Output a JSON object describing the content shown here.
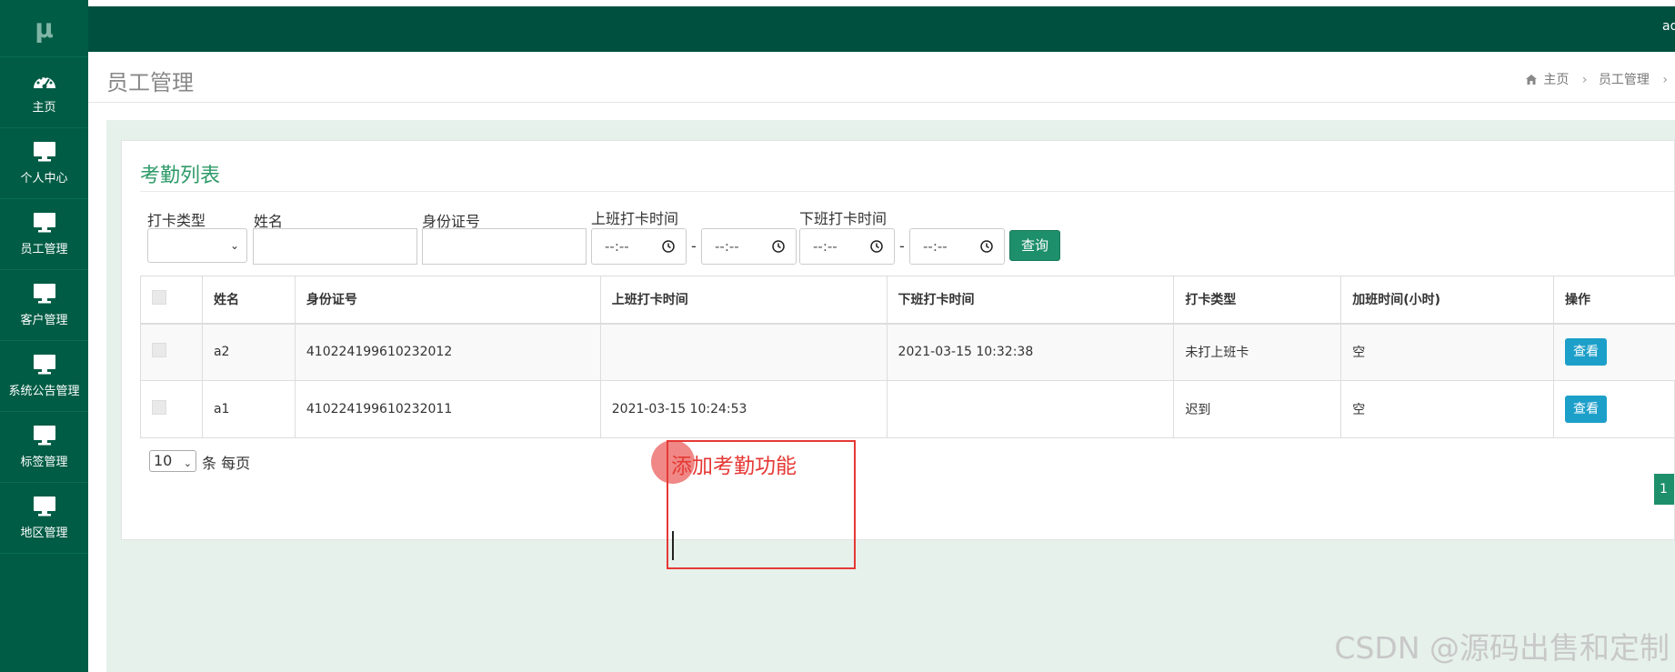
{
  "sidebar": {
    "logo": "μ",
    "items": [
      {
        "label": "主页",
        "icon": "dashboard-icon"
      },
      {
        "label": "个人中心",
        "icon": "monitor-icon"
      },
      {
        "label": "员工管理",
        "icon": "monitor-icon"
      },
      {
        "label": "客户管理",
        "icon": "monitor-icon"
      },
      {
        "label": "系统公告管理",
        "icon": "monitor-icon"
      },
      {
        "label": "标签管理",
        "icon": "monitor-icon"
      },
      {
        "label": "地区管理",
        "icon": "monitor-icon"
      }
    ]
  },
  "topbar": {
    "user": "ad"
  },
  "header": {
    "title": "员工管理",
    "breadcrumb": {
      "home": "主页",
      "section": "员工管理",
      "tail": "›"
    }
  },
  "panel": {
    "title": "考勤列表"
  },
  "filters": {
    "clock_type_label": "打卡类型",
    "clock_type_value": "",
    "name_label": "姓名",
    "name_value": "",
    "id_label": "身份证号",
    "id_value": "",
    "start_label": "上班打卡时间",
    "end_label": "下班打卡时间",
    "time_placeholder": "--:--",
    "separator": "-",
    "query_button": "查询"
  },
  "table": {
    "headers": [
      "姓名",
      "身份证号",
      "上班打卡时间",
      "下班打卡时间",
      "打卡类型",
      "加班时间(小时)",
      "操作"
    ],
    "rows": [
      {
        "name": "a2",
        "id": "410224199610232012",
        "start": "",
        "end": "2021-03-15 10:32:38",
        "type": "未打上班卡",
        "overtime": "空",
        "action": "查看"
      },
      {
        "name": "a1",
        "id": "410224199610232011",
        "start": "2021-03-15 10:24:53",
        "end": "",
        "type": "迟到",
        "overtime": "空",
        "action": "查看"
      }
    ]
  },
  "pagination": {
    "page_size": "10",
    "per_page_label": "条 每页",
    "current_page": "1"
  },
  "annotation": {
    "text": "添加考勤功能",
    "color": "#e53935"
  },
  "watermark": "CSDN @源码出售和定制",
  "colors": {
    "sidebar": "#005c45",
    "topbar": "#005040",
    "accent": "#1e8f6b",
    "view_button": "#1c9fc9"
  }
}
